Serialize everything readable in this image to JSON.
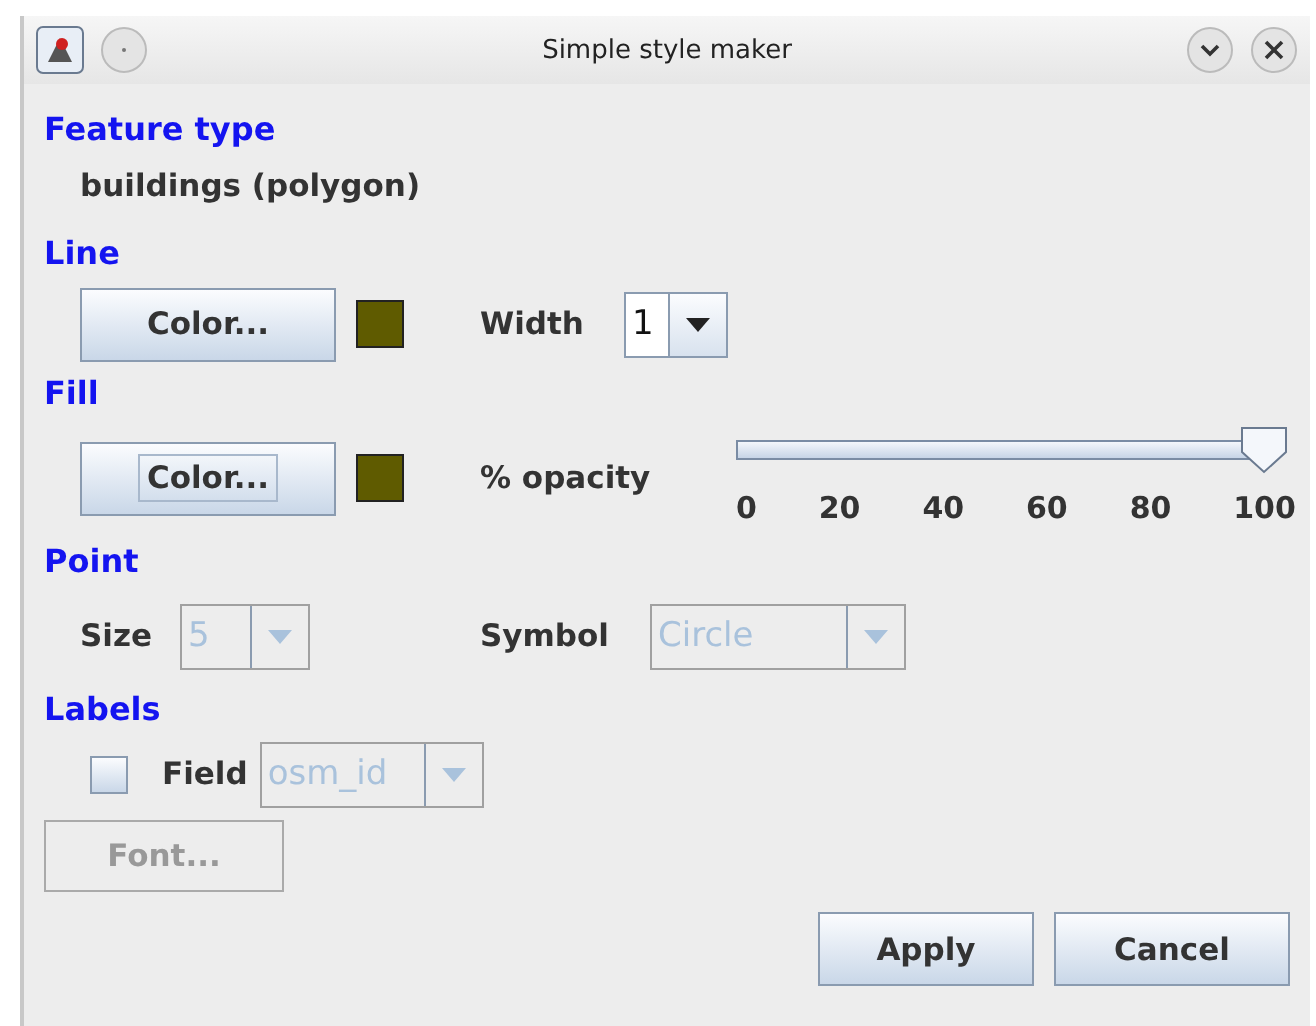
{
  "window": {
    "title": "Simple style maker"
  },
  "feature_type": {
    "heading": "Feature type",
    "value": "buildings (polygon)"
  },
  "line": {
    "heading": "Line",
    "color_button": {
      "label": "Color...",
      "focused": false
    },
    "swatch": {
      "color": "#5f5b00"
    },
    "width_label": "Width",
    "width_value": "1"
  },
  "fill": {
    "heading": "Fill",
    "color_button": {
      "label": "Color...",
      "focused": true
    },
    "swatch": {
      "color": "#5f5b00"
    },
    "opacity_label": "% opacity",
    "opacity": {
      "level": 1,
      "ticks": [
        "0",
        "20",
        "40",
        "60",
        "80",
        "100"
      ]
    }
  },
  "point": {
    "heading": "Point",
    "size_label": "Size",
    "size": {
      "value": "5",
      "disabled": true
    },
    "symbol_label": "Symbol",
    "symbol": {
      "value": "Circle",
      "disabled": true
    }
  },
  "labels": {
    "heading": "Labels",
    "field_checkbox": {
      "checked": false
    },
    "field_label": "Field",
    "field": {
      "value": "osm_id",
      "disabled": true
    },
    "font_button": {
      "label": "Font...",
      "disabled": true
    }
  },
  "buttons": [
    "Apply",
    "Cancel"
  ]
}
